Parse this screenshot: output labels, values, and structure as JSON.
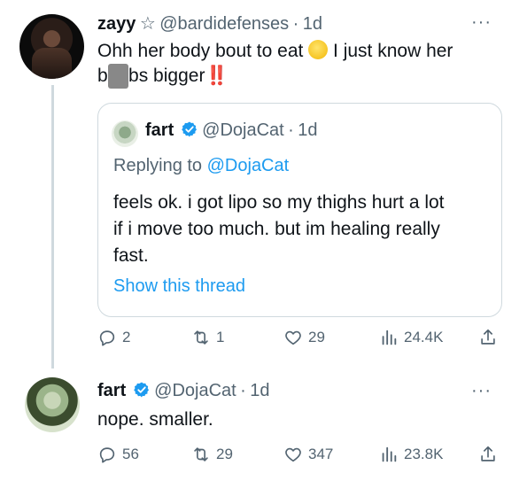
{
  "tweet1": {
    "name": "zayy",
    "star": "☆",
    "handle": "@bardidefenses",
    "dot": "·",
    "time": "1d",
    "more": "···",
    "text_line1": "Ohh her body bout to eat",
    "text_line1b": "I just know her",
    "text_line2_pre": "b",
    "text_line2_censor": "oo",
    "text_line2_post": "bs bigger",
    "text_line2_bang": "‼️"
  },
  "quote": {
    "name": "fart",
    "handle": "@DojaCat",
    "dot": "·",
    "time": "1d",
    "reply_prefix": "Replying to",
    "reply_handle": "@DojaCat",
    "text_line1": "feels ok. i got lipo so my thighs hurt a lot",
    "text_line2": "if i move too much. but im healing really",
    "text_line3": "fast.",
    "show_thread": "Show this thread"
  },
  "tweet1_actions": {
    "replies": "2",
    "retweets": "1",
    "likes": "29",
    "views": "24.4K"
  },
  "tweet2": {
    "name": "fart",
    "handle": "@DojaCat",
    "dot": "·",
    "time": "1d",
    "more": "···",
    "text": "nope. smaller."
  },
  "tweet2_actions": {
    "replies": "56",
    "retweets": "29",
    "likes": "347",
    "views": "23.8K"
  },
  "colors": {
    "accent": "#1d9bf0",
    "muted": "#536471",
    "border": "#cfd9de",
    "text": "#0f1419"
  }
}
